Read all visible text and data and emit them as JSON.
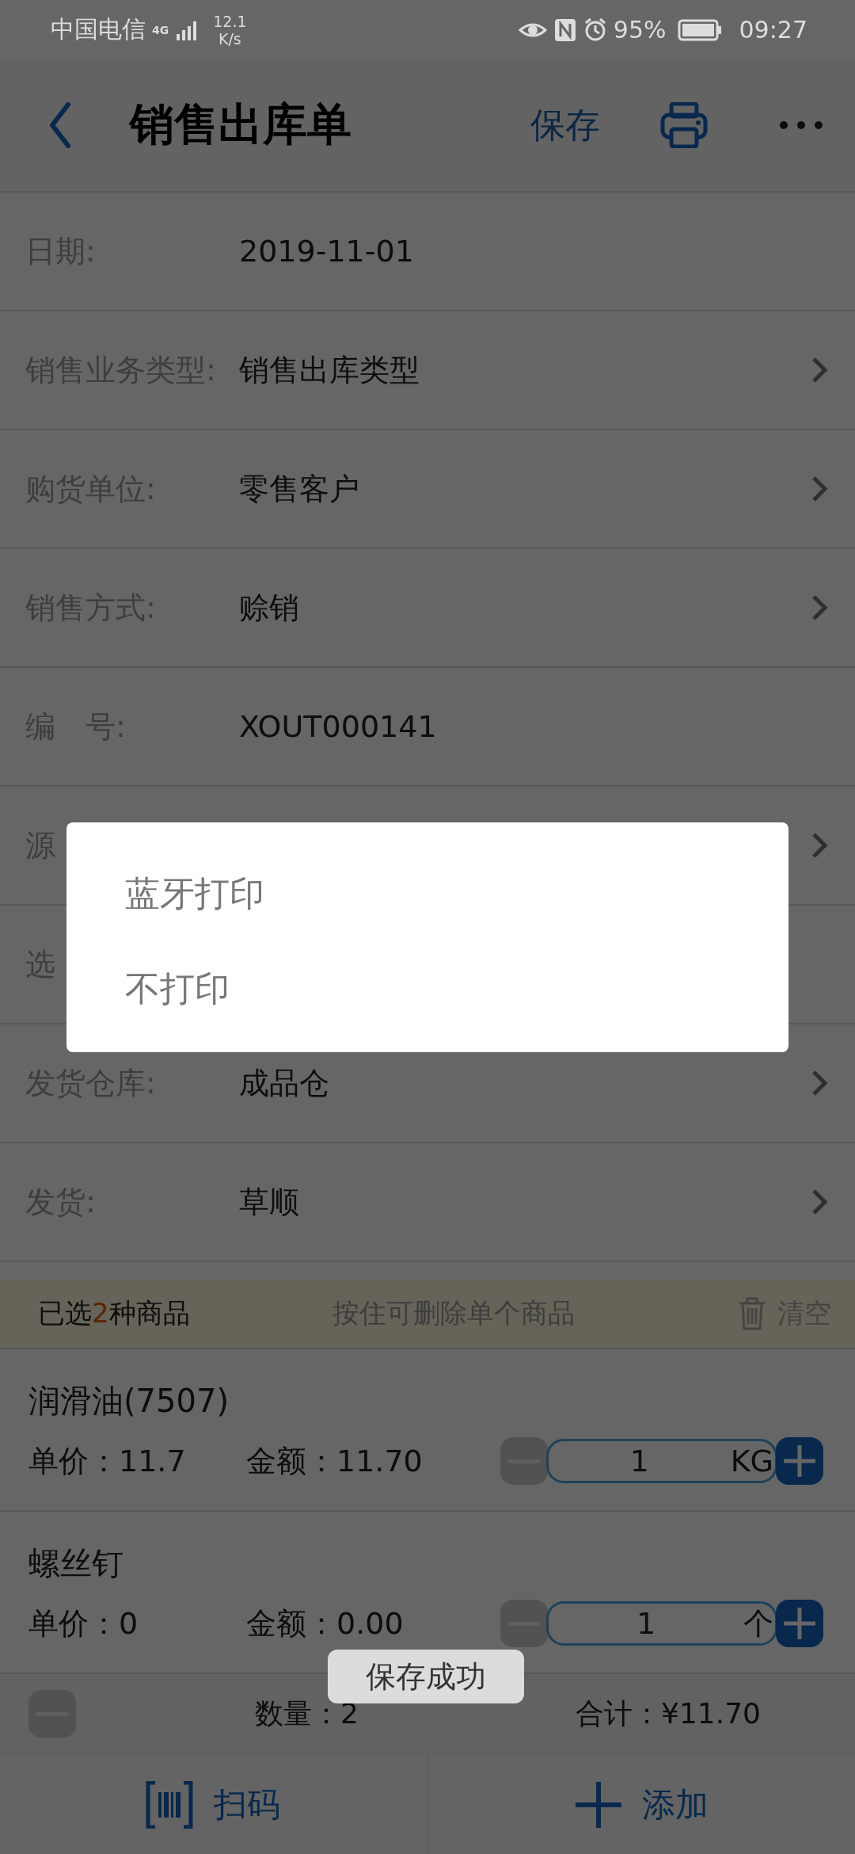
{
  "status_bar": {
    "carrier": "中国电信",
    "network": "4G",
    "speed": "12.1",
    "speed_unit": "K/s",
    "battery": "95%",
    "time": "09:27"
  },
  "header": {
    "title": "销售出库单",
    "save": "保存"
  },
  "fields": [
    {
      "label": "日期:",
      "value": "2019-11-01",
      "chevron": false
    },
    {
      "label": "销售业务类型:",
      "value": "销售出库类型",
      "chevron": true
    },
    {
      "label": "购货单位:",
      "value": "零售客户",
      "chevron": true
    },
    {
      "label": "销售方式:",
      "value": "赊销",
      "chevron": true
    },
    {
      "label": "编　号:",
      "value": "XOUT000141",
      "chevron": false
    },
    {
      "label": "源",
      "chevron": true
    },
    {
      "label": "选",
      "chevron": false
    },
    {
      "label": "发货仓库:",
      "value": "成品仓",
      "chevron": true
    },
    {
      "label": "发货:",
      "value": "草顺",
      "chevron": true
    }
  ],
  "selection_bar": {
    "prefix": "已选",
    "count": "2",
    "suffix": "种商品",
    "hint": "按住可删除单个商品",
    "clear": "清空"
  },
  "items": [
    {
      "name": "润滑油(7507)",
      "price_label": "单价：",
      "price": "11.7",
      "amount_label": "金额：",
      "amount": "11.70",
      "quantity": "1",
      "unit": "KG"
    },
    {
      "name": "螺丝钉",
      "price_label": "单价：",
      "price": "0",
      "amount_label": "金额：",
      "amount": "0.00",
      "quantity": "1",
      "unit": "个"
    }
  ],
  "summary": {
    "quantity_label": "数量：",
    "quantity": "2",
    "total_label": "合计：",
    "total": "¥11.70"
  },
  "actions": [
    {
      "kind": "scan",
      "label": "扫码"
    },
    {
      "kind": "add",
      "label": "添加"
    }
  ],
  "print_dialog": {
    "options": [
      "蓝牙打印",
      "不打印"
    ]
  },
  "toast": "保存成功"
}
